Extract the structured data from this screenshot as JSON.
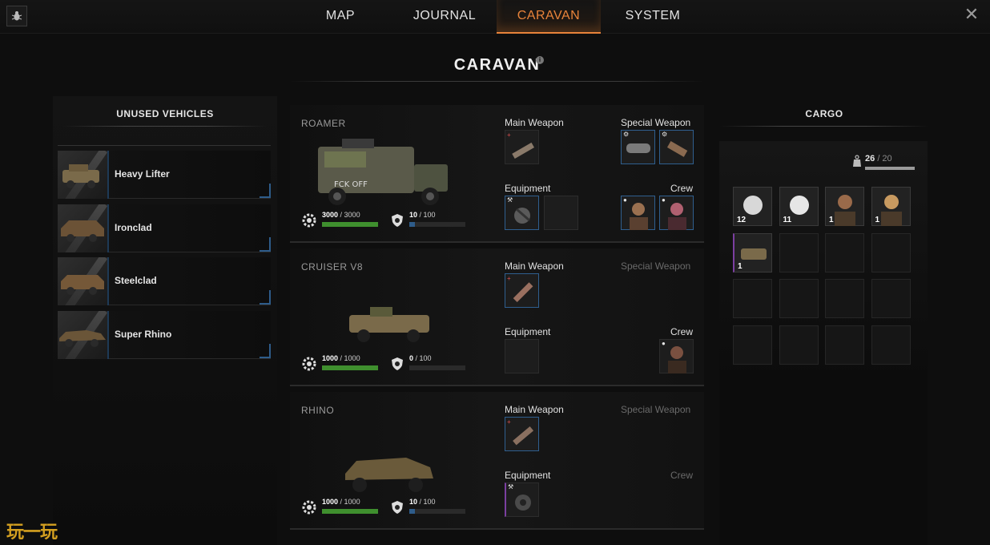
{
  "nav": {
    "tabs": [
      {
        "label": "MAP",
        "active": false
      },
      {
        "label": "JOURNAL",
        "active": false
      },
      {
        "label": "CARAVAN",
        "active": true
      },
      {
        "label": "SYSTEM",
        "active": false
      }
    ],
    "close_label": "✕",
    "accent": "#e8833a"
  },
  "page": {
    "title": "CARAVAN",
    "info_icon": "i"
  },
  "unused_vehicles": {
    "heading": "UNUSED VEHICLES",
    "items": [
      {
        "label": "Heavy Lifter"
      },
      {
        "label": "Ironclad"
      },
      {
        "label": "Steelclad"
      },
      {
        "label": "Super Rhino"
      }
    ]
  },
  "slot_labels": {
    "main_weapon": "Main Weapon",
    "special_weapon": "Special Weapon",
    "equipment": "Equipment",
    "crew": "Crew"
  },
  "vehicles": [
    {
      "name": "ROAMER",
      "durability": "3000",
      "durability_max": "/ 3000",
      "durability_fraction": 1.0,
      "armor": "10",
      "armor_max": "/ 100",
      "armor_fraction": 0.1
    },
    {
      "name": "CRUISER V8",
      "durability": "1000",
      "durability_max": "/ 1000",
      "durability_fraction": 1.0,
      "armor": "0",
      "armor_max": "/ 100",
      "armor_fraction": 0.0
    },
    {
      "name": "RHINO",
      "durability": "1000",
      "durability_max": "/ 1000",
      "durability_fraction": 1.0,
      "armor": "10",
      "armor_max": "/ 100",
      "armor_fraction": 0.1
    }
  ],
  "cargo": {
    "heading": "CARGO",
    "weight": "26",
    "weight_max": "/ 20",
    "weight_fraction": 1.0,
    "counts": [
      "12",
      "11",
      "1",
      "1",
      "1"
    ]
  },
  "colors": {
    "durability_bar": "#3f8f2e",
    "armor_bar": "#2e5c8a",
    "slot_blue": "#2f5f8f"
  },
  "watermark": "玩一玩"
}
